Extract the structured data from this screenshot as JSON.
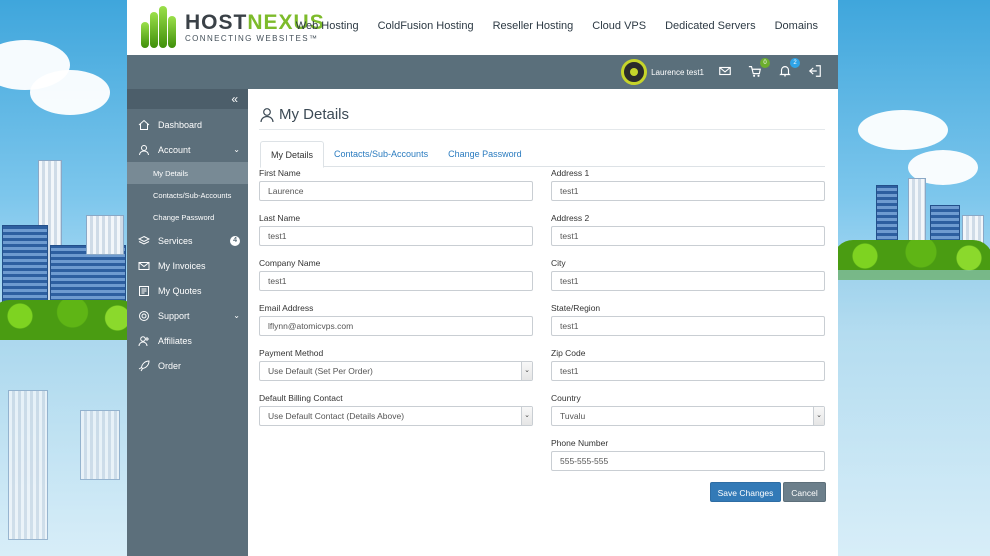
{
  "header": {
    "logo_primary": "HOST",
    "logo_accent": "NEXUS",
    "logo_tagline": "CONNECTING WEBSITES™",
    "nav": [
      "Web Hosting",
      "ColdFusion Hosting",
      "Reseller Hosting",
      "Cloud VPS",
      "Dedicated Servers",
      "Domains"
    ]
  },
  "userbar": {
    "username": "Laurence test1",
    "cart_count": "0",
    "notification_count": "2",
    "icons": [
      "mail-icon",
      "cart-icon",
      "bell-icon",
      "logout-icon"
    ]
  },
  "sidebar": {
    "collapse_label": "«",
    "items": [
      {
        "label": "Dashboard",
        "icon": "home-icon"
      },
      {
        "label": "Account",
        "icon": "user-icon",
        "caret": "⌄"
      },
      {
        "label": "Services",
        "icon": "layers-icon",
        "count": "4"
      },
      {
        "label": "My Invoices",
        "icon": "envelope-icon"
      },
      {
        "label": "My Quotes",
        "icon": "quote-icon"
      },
      {
        "label": "Support",
        "icon": "lifebuoy-icon",
        "caret": "⌄"
      },
      {
        "label": "Affiliates",
        "icon": "affiliates-icon"
      },
      {
        "label": "Order",
        "icon": "rocket-icon"
      }
    ],
    "sub_items": [
      "My Details",
      "Contacts/Sub-Accounts",
      "Change Password"
    ]
  },
  "page": {
    "title": "My Details",
    "tabs": [
      "My Details",
      "Contacts/Sub-Accounts",
      "Change Password"
    ]
  },
  "form": {
    "first_name": {
      "label": "First Name",
      "value": "Laurence"
    },
    "last_name": {
      "label": "Last Name",
      "value": "test1"
    },
    "company": {
      "label": "Company Name",
      "value": "test1"
    },
    "email": {
      "label": "Email Address",
      "value": "lflynn@atomicvps.com"
    },
    "payment": {
      "label": "Payment Method",
      "value": "Use Default (Set Per Order)"
    },
    "billing": {
      "label": "Default Billing Contact",
      "value": "Use Default Contact (Details Above)"
    },
    "address1": {
      "label": "Address 1",
      "value": "test1"
    },
    "address2": {
      "label": "Address 2",
      "value": "test1"
    },
    "city": {
      "label": "City",
      "value": "test1"
    },
    "state": {
      "label": "State/Region",
      "value": "test1"
    },
    "zip": {
      "label": "Zip Code",
      "value": "test1"
    },
    "country": {
      "label": "Country",
      "value": "Tuvalu"
    },
    "phone": {
      "label": "Phone Number",
      "value": "555-555-555"
    },
    "save_label": "Save Changes",
    "cancel_label": "Cancel"
  },
  "colors": {
    "brand_green": "#7dbb2b",
    "sidebar_bg": "#5c6f7b",
    "primary_button": "#337ab7",
    "link": "#2a7bbf"
  }
}
